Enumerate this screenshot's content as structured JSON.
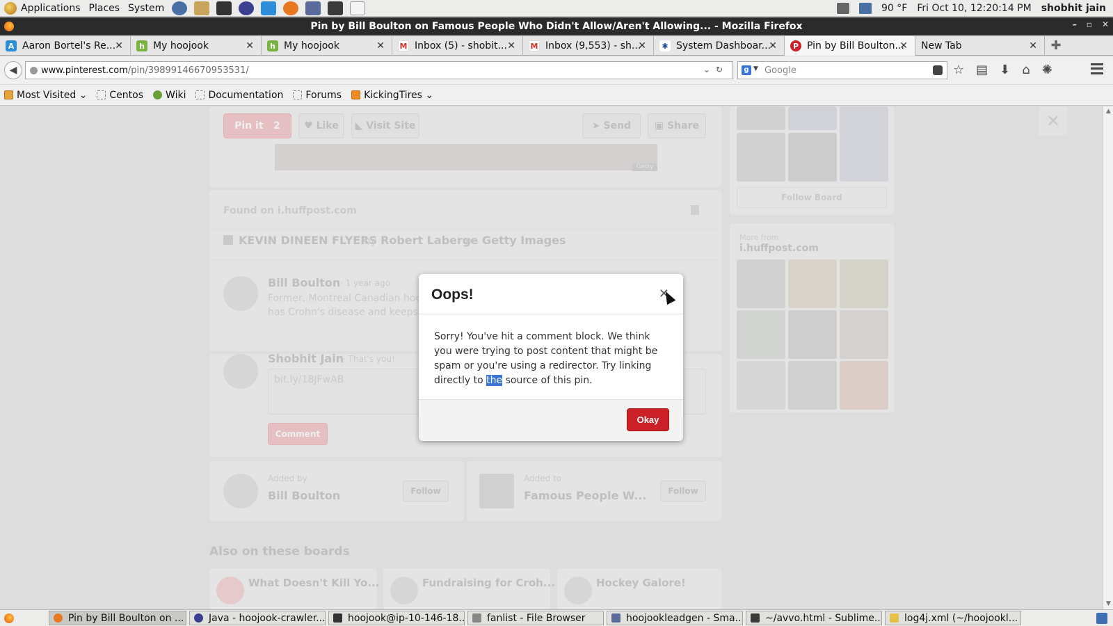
{
  "top_panel": {
    "menus": [
      "Applications",
      "Places",
      "System"
    ],
    "temperature": "90 °F",
    "datetime": "Fri Oct 10, 12:20:14 PM",
    "user": "shobhit jain"
  },
  "window": {
    "title": "Pin by Bill Boulton on Famous People Who Didn't Allow/Aren't Allowing... - Mozilla Firefox"
  },
  "tabs": [
    {
      "label": "Aaron Bortel's Re...",
      "icon": "A",
      "color": "#2a8fd6"
    },
    {
      "label": "My hoojook",
      "icon": "h",
      "color": "#7ab342"
    },
    {
      "label": "My hoojook",
      "icon": "h",
      "color": "#7ab342"
    },
    {
      "label": "Inbox (5) - shobit...",
      "icon": "M",
      "color": "#d93025"
    },
    {
      "label": "Inbox (9,553) - sh...",
      "icon": "M",
      "color": "#d93025"
    },
    {
      "label": "System Dashboar...",
      "icon": "✱",
      "color": "#1f4e9c"
    },
    {
      "label": "Pin by Bill Boulton...",
      "icon": "P",
      "color": "#cb2027"
    },
    {
      "label": "New Tab",
      "icon": "",
      "color": ""
    }
  ],
  "navbar": {
    "url_domain": "www.pinterest.com",
    "url_path": "/pin/39899146670953531/",
    "search_placeholder": "Google"
  },
  "bookmarks": [
    "Most Visited",
    "Centos",
    "Wiki",
    "Documentation",
    "Forums",
    "KickingTires"
  ],
  "page": {
    "pin_it": "Pin it",
    "pin_count": "2",
    "like": "Like",
    "visit_site": "Visit Site",
    "send": "Send",
    "share": "Share",
    "getty": "Getty",
    "found_on": "Found on i.huffpost.com",
    "credit_title": "KEVIN DINEEN FLYERS",
    "credit_by": "by",
    "credit_author": "Robert Laberge",
    "credit_on": "on",
    "credit_source": "Getty Images",
    "commenter_name": "Bill Boulton",
    "commenter_time": "· 1 year ago",
    "comment_line1": "Former, Montreal Canadian hock",
    "comment_line2": "has Crohn's disease and keeps li",
    "me_name": "Shobhit Jain",
    "me_note": "· That's you!",
    "comment_input": "bit.ly/18JFwAB",
    "comment_button": "Comment",
    "added_by_label": "Added by",
    "added_by_name": "Bill Boulton",
    "follow": "Follow",
    "added_to_label": "Added to",
    "added_to_board": "Famous People W...",
    "also_on": "Also on these boards",
    "board1": "What Doesn't Kill Yo...",
    "board2": "Fundraising for Croh...",
    "board3": "Hockey Galore!",
    "follow_board": "Follow Board",
    "more_from": "More from",
    "more_from_site": "i.huffpost.com"
  },
  "modal": {
    "title": "Oops!",
    "body_before": "Sorry! You've hit a comment block. We think you were trying to post content that might be spam or you're using a redirector. Try linking directly to ",
    "body_selected": "the",
    "body_after": " source of this pin.",
    "ok_button": "Okay"
  },
  "taskbar": [
    "Pin by Bill Boulton on ...",
    "Java - hoojook-crawler...",
    "hoojook@ip-10-146-18...",
    "fanlist - File Browser",
    "hoojookleadgen - Sma...",
    "~/avvo.html - Sublime...",
    "log4j.xml (~/hoojookl..."
  ]
}
